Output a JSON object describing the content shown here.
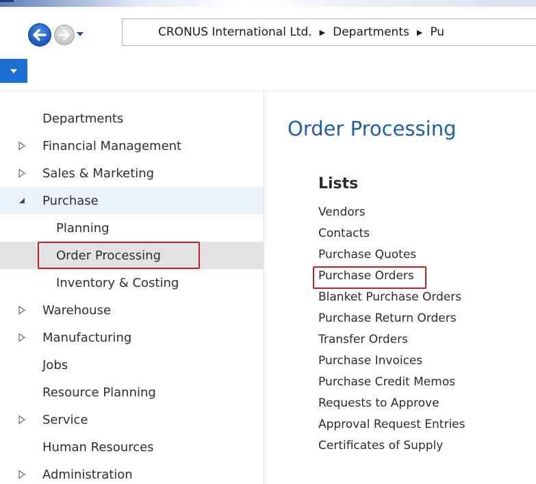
{
  "window": {
    "colors": {
      "accent": "#1c6fd0",
      "title": "#1f5fa8",
      "highlight": "#c32026"
    }
  },
  "toolbar": {
    "back_icon": "arrow-left-icon",
    "forward_icon": "arrow-right-icon",
    "history_icon": "chevron-down-icon"
  },
  "address": {
    "crumbs": [
      "CRONUS International Ltd.",
      "Departments",
      "Pu"
    ]
  },
  "menu_button": {
    "icon": "chevron-down-icon"
  },
  "navigation": {
    "items": [
      {
        "label": "Departments",
        "expander": "none"
      },
      {
        "label": "Financial Management",
        "expander": "collapsed"
      },
      {
        "label": "Sales & Marketing",
        "expander": "collapsed"
      },
      {
        "label": "Purchase",
        "expander": "expanded"
      },
      {
        "label": "Planning",
        "expander": "child"
      },
      {
        "label": "Order Processing",
        "expander": "child",
        "selected": true
      },
      {
        "label": "Inventory & Costing",
        "expander": "child"
      },
      {
        "label": "Warehouse",
        "expander": "collapsed"
      },
      {
        "label": "Manufacturing",
        "expander": "collapsed"
      },
      {
        "label": "Jobs",
        "expander": "none"
      },
      {
        "label": "Resource Planning",
        "expander": "none"
      },
      {
        "label": "Service",
        "expander": "collapsed"
      },
      {
        "label": "Human Resources",
        "expander": "none"
      },
      {
        "label": "Administration",
        "expander": "collapsed"
      }
    ]
  },
  "main": {
    "title": "Order Processing",
    "group_heading": "Lists",
    "links": [
      "Vendors",
      "Contacts",
      "Purchase Quotes",
      "Purchase Orders",
      "Blanket Purchase Orders",
      "Purchase Return Orders",
      "Transfer Orders",
      "Purchase Invoices",
      "Purchase Credit Memos",
      "Requests to Approve",
      "Approval Request Entries",
      "Certificates of Supply"
    ]
  }
}
